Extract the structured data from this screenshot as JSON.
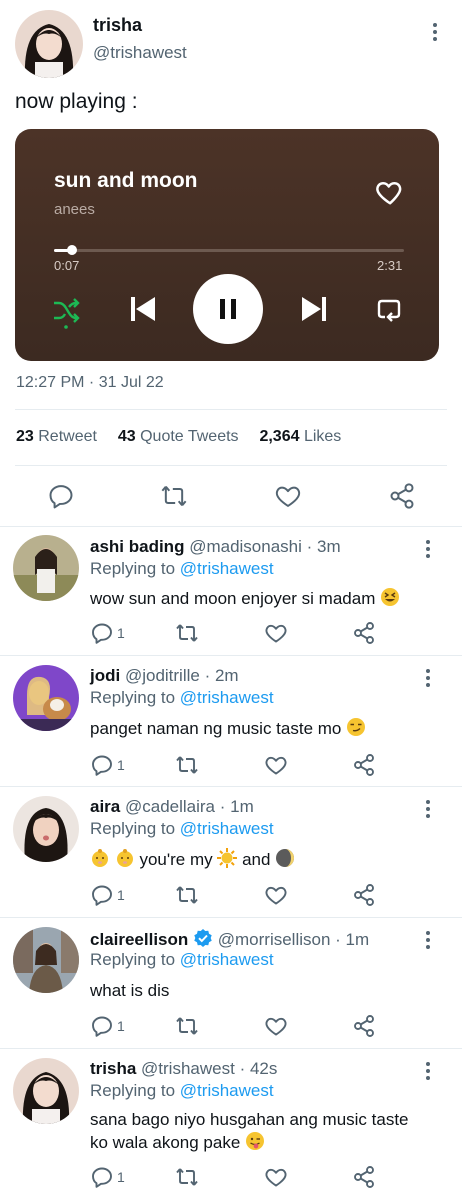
{
  "tweet": {
    "name": "trisha",
    "handle": "@trishawest",
    "text": "now playing :",
    "timestamp": "12:27 PM · 31 Jul 22",
    "stats": {
      "retweets_count": "23",
      "retweets_label": "Retweet",
      "quotes_count": "43",
      "quotes_label": "Quote Tweets",
      "likes_count": "2,364",
      "likes_label": "Likes"
    }
  },
  "player": {
    "title": "sun and moon",
    "artist": "anees",
    "current_time": "0:07",
    "total_time": "2:31",
    "progress": 0.05,
    "background": "#4c3327",
    "shuffle_color": "#1db954"
  },
  "replies": [
    {
      "name": "ashi bading",
      "handle": "@madisonashi",
      "time": "· 3m",
      "replying_label": "Replying to",
      "mention": "@trishawest",
      "text": "wow sun and moon enjoyer si madam",
      "emoji": "grinning-squint-face",
      "reply_count": "1"
    },
    {
      "name": "jodi",
      "handle": "@joditrille",
      "time": "· 2m",
      "replying_label": "Replying to",
      "mention": "@trishawest",
      "text": "panget naman ng music taste mo",
      "emoji": "smirking-face",
      "reply_count": "1"
    },
    {
      "name": "aira",
      "handle": "@cadellaira",
      "time": "· 1m",
      "replying_label": "Replying to",
      "mention": "@trishawest",
      "text_part1": "you're my",
      "text_part2": "and",
      "emoji": "baby-sun-moon",
      "reply_count": "1"
    },
    {
      "name": "claireellison",
      "handle": "@morrisellison",
      "time": "· 1m",
      "replying_label": "Replying to",
      "mention": "@trishawest",
      "text": "what is dis",
      "verified": true,
      "reply_count": "1"
    },
    {
      "name": "trisha",
      "handle": "@trishawest",
      "time": "· 42s",
      "replying_label": "Replying to",
      "mention": "@trishawest",
      "text": "sana bago niyo husgahan ang music taste ko wala akong pake",
      "emoji": "winking-tongue-face",
      "reply_count": "1"
    }
  ],
  "colors": {
    "accent": "#1d9bf0",
    "secondary_text": "#536471"
  }
}
